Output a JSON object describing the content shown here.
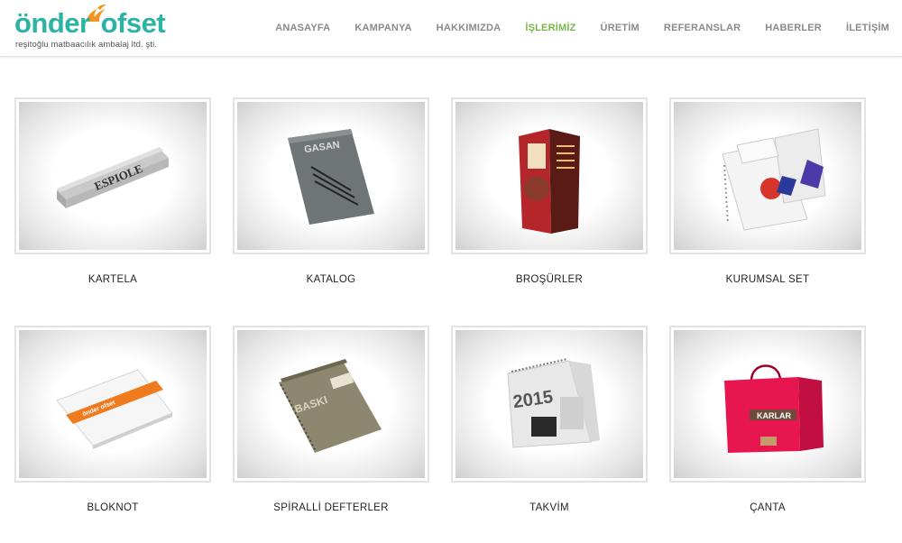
{
  "brand": {
    "name_part1": "önder",
    "name_part2": "ofset",
    "tagline": "reşitoğlu matbaacılık ambalaj ltd. şti.",
    "accent_color": "#2bb3a4",
    "flame_color": "#f2941f"
  },
  "nav": {
    "active_color": "#7ab648",
    "items": [
      {
        "label": "ANASAYFA",
        "active": false
      },
      {
        "label": "KAMPANYA",
        "active": false
      },
      {
        "label": "HAKKIMIZDA",
        "active": false
      },
      {
        "label": "İŞLERİMİZ",
        "active": true
      },
      {
        "label": "ÜRETİM",
        "active": false
      },
      {
        "label": "REFERANSLAR",
        "active": false
      },
      {
        "label": "HABERLER",
        "active": false
      },
      {
        "label": "İLETİŞİM",
        "active": false
      }
    ]
  },
  "products": [
    {
      "label": "KARTELA",
      "icon": "kartela-image",
      "print": "ESPIOLE"
    },
    {
      "label": "KATALOG",
      "icon": "katalog-image",
      "print": "GASAN"
    },
    {
      "label": "BROŞÜRLER",
      "icon": "brosur-image",
      "print": ""
    },
    {
      "label": "KURUMSAL SET",
      "icon": "kurumsal-set-image",
      "print": ""
    },
    {
      "label": "BLOKNOT",
      "icon": "bloknot-image",
      "print": ""
    },
    {
      "label": "SPİRALLİ DEFTERLER",
      "icon": "spiralli-defter-image",
      "print": "BASKI"
    },
    {
      "label": "TAKVİM",
      "icon": "takvim-image",
      "print": "2015"
    },
    {
      "label": "ÇANTA",
      "icon": "canta-image",
      "print": "KARLAR"
    }
  ]
}
